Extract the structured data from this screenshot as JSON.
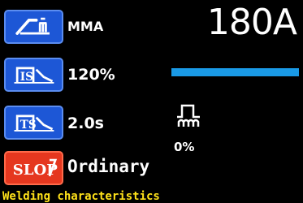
{
  "menu": {
    "mode": {
      "icon": "electrode-holder-icon",
      "value": "MMA"
    },
    "arc_force": {
      "icon": "arc-force-icon",
      "value": "120%"
    },
    "time": {
      "icon": "time-setting-icon",
      "value": "2.0s"
    },
    "characteristic": {
      "icon": "slope-icon",
      "icon_text": "SLOP",
      "value": "Ordinary"
    }
  },
  "current": {
    "value": "180A",
    "bar_fraction": 1.0
  },
  "pulse": {
    "icon": "pulse-wave-icon",
    "value": "0%"
  },
  "status": {
    "label": "Welding characteristics"
  },
  "colors": {
    "button_blue": "#1d57d6",
    "button_red": "#e5371f",
    "bar": "#1a9ae6",
    "status_yellow": "#ffe21a"
  }
}
